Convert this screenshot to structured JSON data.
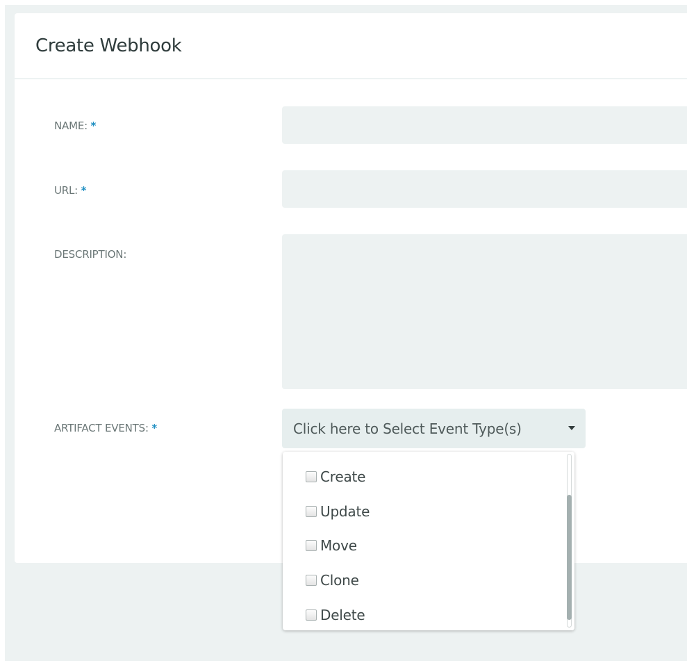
{
  "dialog": {
    "title": "Create Webhook"
  },
  "form": {
    "name": {
      "label": "NAME:",
      "required_mark": "*",
      "value": ""
    },
    "url": {
      "label": "URL:",
      "required_mark": "*",
      "value": ""
    },
    "description": {
      "label": "DESCRIPTION:",
      "value": ""
    },
    "artifact_events": {
      "label": "ARTIFACT EVENTS:",
      "required_mark": "*",
      "placeholder": "Click here to Select Event Type(s)",
      "caret_icon": "caret-down-icon",
      "options": [
        {
          "label": "Create",
          "checked": false
        },
        {
          "label": "Update",
          "checked": false
        },
        {
          "label": "Move",
          "checked": false
        },
        {
          "label": "Clone",
          "checked": false
        },
        {
          "label": "Delete",
          "checked": false
        }
      ]
    }
  },
  "colors": {
    "page_background": "#edf2f2",
    "panel": "#ffffff",
    "input_background": "#edf2f2",
    "required_accent": "#1f8fc2",
    "scrollbar_thumb": "#a4b0b0"
  }
}
